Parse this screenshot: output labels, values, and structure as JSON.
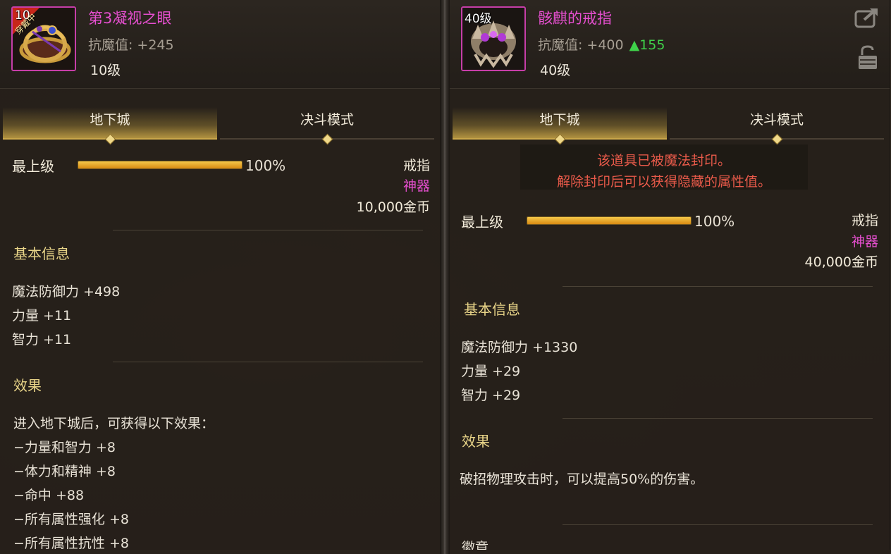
{
  "colors": {
    "rarity": "#e64fd0",
    "section": "#e8d488",
    "seal": "#e85a4a",
    "increase": "#3fd24a",
    "grade_bar": "#f0b030"
  },
  "left": {
    "icon": {
      "name": "ring-artifact-icon",
      "level_tag": "10",
      "badge": "穿戴中"
    },
    "name": "第3凝视之眼",
    "resist_label": "抗魔值:",
    "resist_value": "+245",
    "required_level": "10级",
    "tabs": [
      "地下城",
      "决斗模式"
    ],
    "grade_label": "最上级",
    "grade_percent": "100%",
    "grade_fill": 1.0,
    "item_type": "戒指",
    "rarity": "神器",
    "price": "10,000金币",
    "basic_title": "基本信息",
    "stats": [
      "魔法防御力 +498",
      "力量 +11",
      "智力 +11"
    ],
    "effect_title": "效果",
    "effects": [
      "进入地下城后，可获得以下效果：",
      "−力量和智力 +8",
      "−体力和精神 +8",
      "−命中 +88",
      "−所有属性强化 +8",
      "−所有属性抗性 +8"
    ]
  },
  "right": {
    "icon": {
      "name": "skull-ring-icon",
      "level_tag": "40级"
    },
    "name": "骸麒的戒指",
    "resist_label": "抗魔值:",
    "resist_value": "+400",
    "resist_increase": "▲155",
    "required_level": "40级",
    "tabs": [
      "地下城",
      "决斗模式"
    ],
    "seal_lines": [
      "该道具已被魔法封印。",
      "解除封印后可以获得隐藏的属性值。"
    ],
    "grade_label": "最上级",
    "grade_percent": "100%",
    "grade_fill": 1.0,
    "item_type": "戒指",
    "rarity": "神器",
    "price": "40,000金币",
    "basic_title": "基本信息",
    "stats": [
      "魔法防御力 +1330",
      "力量 +29",
      "智力 +29"
    ],
    "effect_title": "效果",
    "effects": [
      "破招物理攻击时，可以提高50%的伤害。"
    ],
    "cut_title": "徽章"
  }
}
